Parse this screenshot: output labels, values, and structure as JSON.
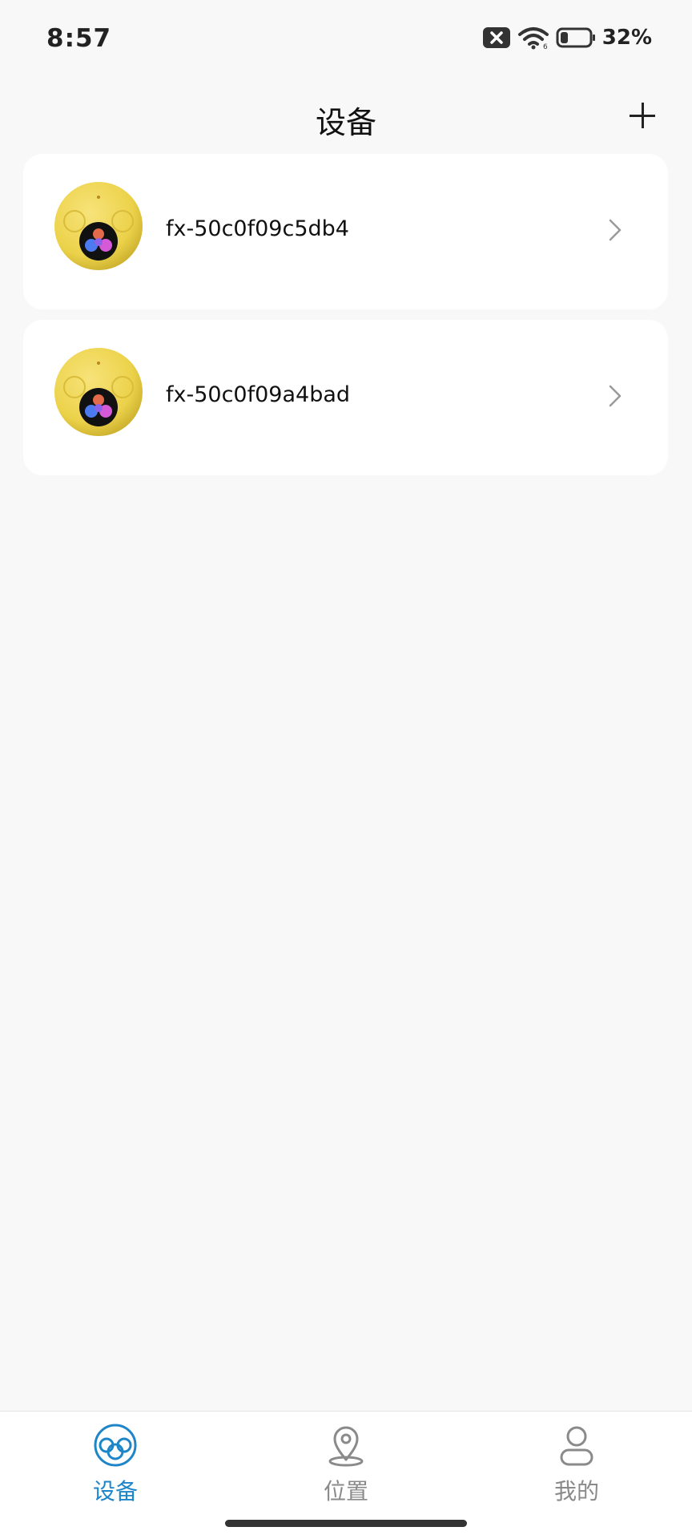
{
  "status_bar": {
    "time": "8:57",
    "icons": [
      "sim-off-icon",
      "wifi-icon",
      "battery-icon"
    ],
    "battery_percent": "32%"
  },
  "header": {
    "title": "设备",
    "add_icon": "plus-icon"
  },
  "devices": [
    {
      "name": "fx-50c0f09c5db4",
      "icon": "device-image"
    },
    {
      "name": "fx-50c0f09a4bad",
      "icon": "device-image"
    }
  ],
  "tabs": [
    {
      "label": "设备",
      "icon": "device-tab-icon",
      "active": true
    },
    {
      "label": "位置",
      "icon": "location-pin-icon",
      "active": false
    },
    {
      "label": "我的",
      "icon": "user-icon",
      "active": false
    }
  ],
  "colors": {
    "accent": "#1e86c8",
    "background": "#f8f8f8",
    "card": "#ffffff",
    "inactive": "#8a8a8a",
    "device_yellow": "#f0d64a"
  }
}
